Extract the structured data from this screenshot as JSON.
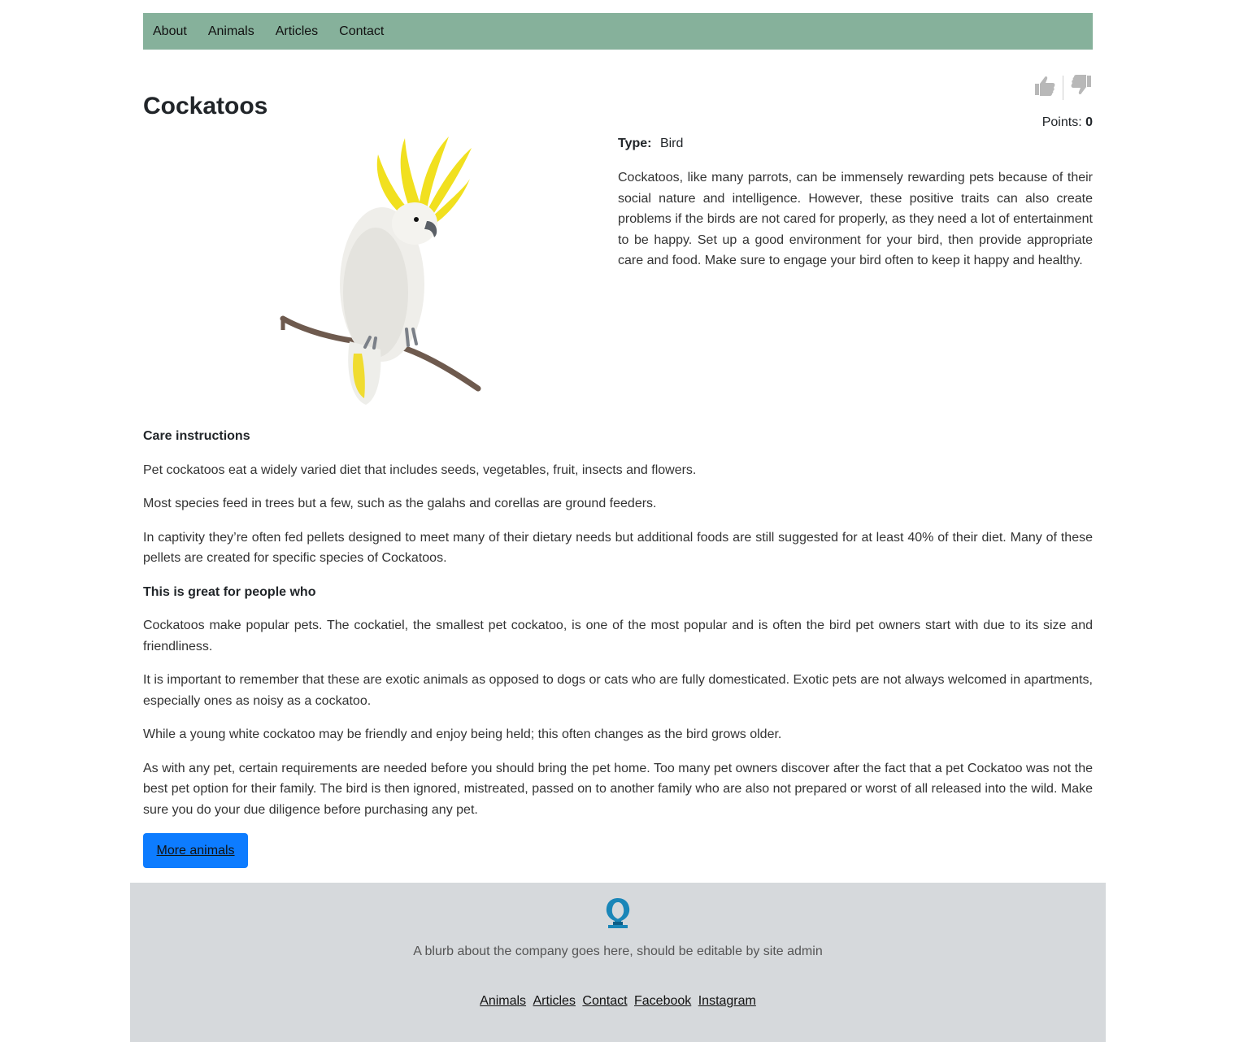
{
  "nav": {
    "items": [
      "About",
      "Animals",
      "Articles",
      "Contact"
    ]
  },
  "vote": {
    "up_icon": "thumbs-up-icon",
    "down_icon": "thumbs-down-icon",
    "points_label": "Points:",
    "points_value": "0"
  },
  "animal": {
    "title": "Cockatoos",
    "type_label": "Type:",
    "type_value": "Bird",
    "description": "Cockatoos, like many parrots, can be immensely rewarding pets because of their social nature and intelligence. However, these positive traits can also create problems if the birds are not cared for properly, as they need a lot of entertainment to be happy. Set up a good environment for your bird, then provide appropriate care and food. Make sure to engage your bird often to keep it happy and healthy."
  },
  "care": {
    "heading": "Care instructions",
    "paragraphs": [
      "Pet cockatoos eat a widely varied diet that includes seeds, vegetables, fruit, insects and flowers.",
      "Most species feed in trees but a few, such as the galahs and corellas are ground feeders.",
      "In captivity they’re often fed pellets designed to meet many of their dietary needs but additional foods are still suggested for at least 40% of their diet. Many of these pellets are created for specific species of Cockatoos."
    ]
  },
  "great_for": {
    "heading": "This is great for people who",
    "paragraphs": [
      "Cockatoos make popular pets. The cockatiel, the smallest pet cockatoo, is one of the most popular and is often the bird pet owners start with due to its size and friendliness.",
      "It is important to remember that these are exotic animals as opposed to dogs or cats who are fully domesticated. Exotic pets are not always welcomed in apartments, especially ones as noisy as a cockatoo.",
      "While a young white cockatoo may be friendly and enjoy being held; this often changes as the bird grows older.",
      "As with any pet, certain requirements are needed before you should bring the pet home. Too many pet owners discover after the fact that a pet Cockatoo was not the best pet option for their family. The bird is then ignored, mistreated, passed on to another family who are also not prepared or worst of all released into the wild. Make sure you do your due diligence before purchasing any pet."
    ]
  },
  "more_button": "More animals",
  "footer": {
    "logo_icon": "omega-logo-icon",
    "blurb": "A blurb about the company goes here, should be editable by site admin",
    "links": [
      "Animals",
      "Articles",
      "Contact",
      "Facebook",
      "Instagram"
    ]
  },
  "colors": {
    "nav_bg": "#86b19b",
    "button_bg": "#0d7cff",
    "footer_bg": "#d6d9dc",
    "logo": "#1a86b8"
  }
}
